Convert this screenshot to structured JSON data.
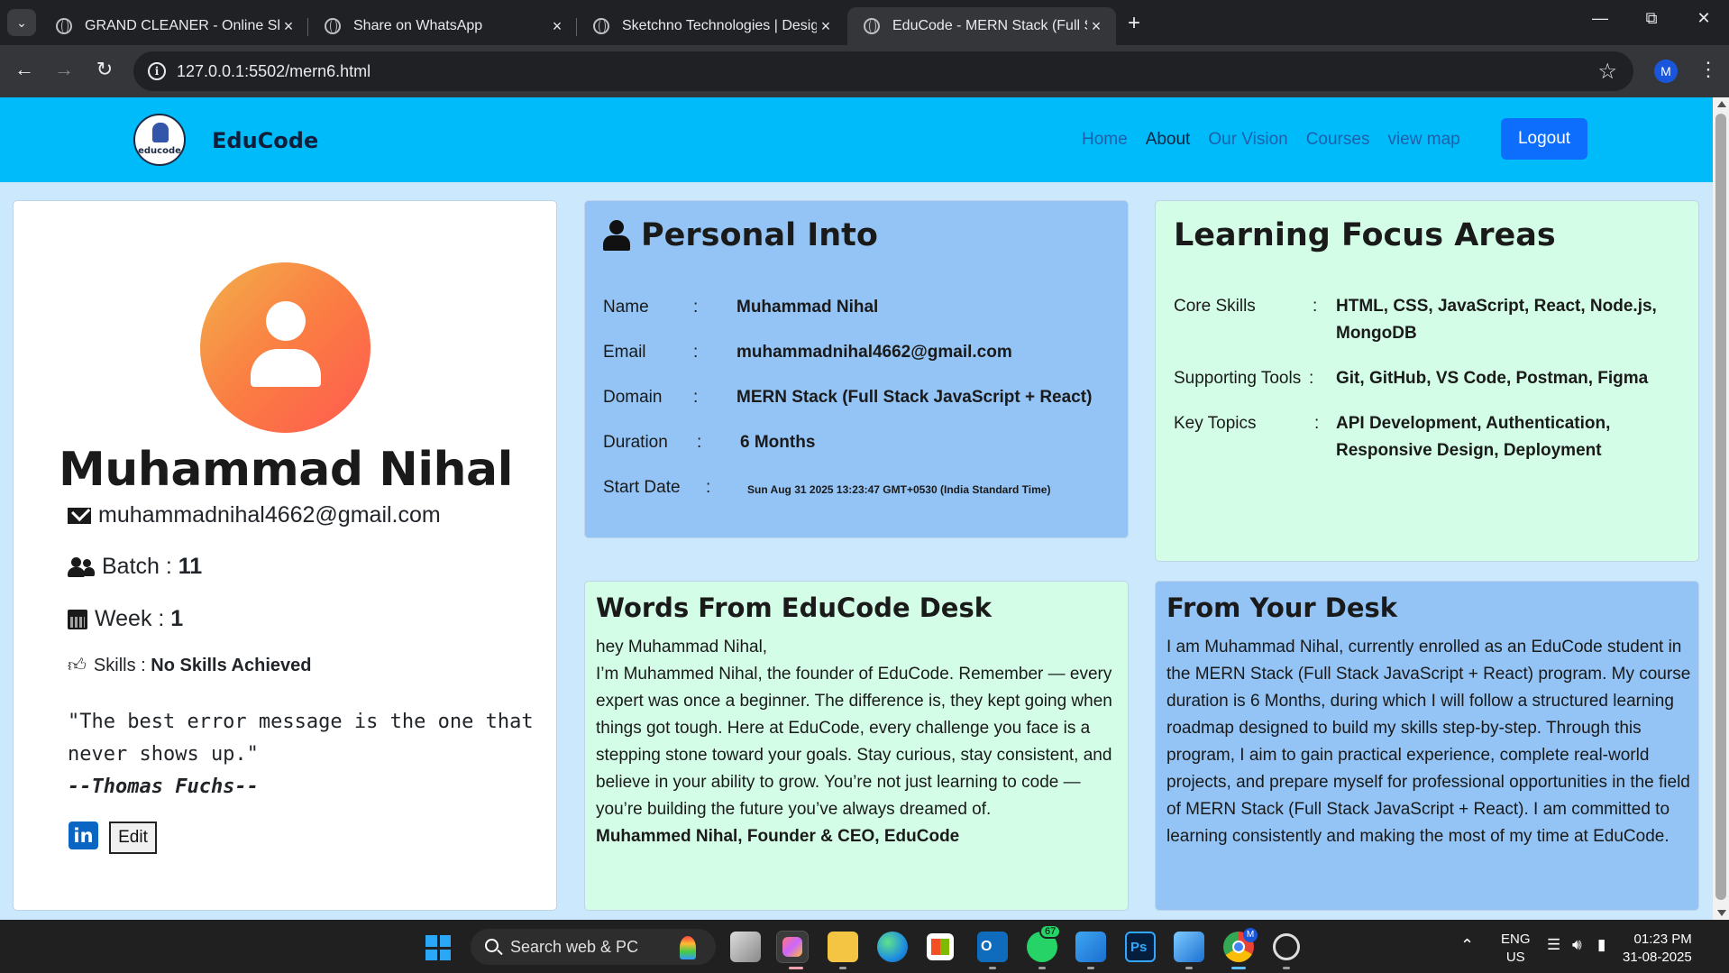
{
  "browser": {
    "tabs": [
      {
        "title": "GRAND CLEANER - Online Shop"
      },
      {
        "title": "Share on WhatsApp"
      },
      {
        "title": "Sketchno Technologies | Design"
      },
      {
        "title": "EduCode - MERN Stack (Full Stack"
      }
    ],
    "url": "127.0.0.1:5502/mern6.html",
    "profile_initial": "M"
  },
  "navbar": {
    "logo_text": "educode",
    "brand": "EduCode",
    "links": [
      "Home",
      "About",
      "Our Vision",
      "Courses",
      "view map"
    ],
    "active_link": "About",
    "logout": "Logout",
    "color": "#00bbfa"
  },
  "profile": {
    "name": "Muhammad Nihal",
    "email": "muhammadnihal4662@gmail.com",
    "batch_label": "Batch :",
    "batch": "11",
    "week_label": "Week :",
    "week": "1",
    "skills_label": "Skills :",
    "skills": "No Skills Achieved",
    "quote": "\"The best error message is the one that never shows up.\"",
    "quote_author": "--Thomas Fuchs--",
    "linkedin_text": "in",
    "edit": "Edit"
  },
  "personal": {
    "title": "Personal Into",
    "rows": [
      {
        "label": "Name",
        "value": "Muhammad Nihal"
      },
      {
        "label": "Email",
        "value": "muhammadnihal4662@gmail.com"
      },
      {
        "label": "Domain",
        "value": "MERN Stack (Full Stack JavaScript + React)"
      },
      {
        "label": "Duration",
        "value": "6 Months"
      },
      {
        "label": "Start Date",
        "value": "Sun Aug 31 2025 13:23:47 GMT+0530 (India Standard Time)"
      }
    ]
  },
  "focus": {
    "title": "Learning Focus Areas",
    "rows": [
      {
        "label": "Core Skills",
        "value": "HTML, CSS, JavaScript, React, Node.js, MongoDB"
      },
      {
        "label": "Supporting Tools",
        "value": "Git, GitHub, VS Code, Postman, Figma"
      },
      {
        "label": "Key Topics",
        "value": "API Development, Authentication, Responsive Design, Deployment"
      }
    ]
  },
  "words": {
    "title": "Words From EduCode Desk",
    "greeting": "hey Muhammad Nihal,",
    "body": "I’m Muhammed Nihal, the founder of EduCode. Remember — every expert was once a beginner. The difference is, they kept going when things got tough. Here at EduCode, every challenge you face is a stepping stone toward your goals. Stay curious, stay consistent, and believe in your ability to grow. You’re not just learning to code — you’re building the future you’ve always dreamed of.",
    "signature": "Muhammed Nihal, Founder & CEO, EduCode"
  },
  "desk": {
    "title": "From Your Desk",
    "body": "I am Muhammad Nihal, currently enrolled as an EduCode student in the MERN Stack (Full Stack JavaScript + React) program. My course duration is 6 Months, during which I will follow a structured learning roadmap designed to build my skills step-by-step. Through this program, I aim to gain practical experience, complete real-world projects, and prepare myself for professional opportunities in the field of MERN Stack (Full Stack JavaScript + React). I am committed to learning consistently and making the most of my time at EduCode."
  },
  "taskbar": {
    "search_placeholder": "Search web & PC",
    "whatsapp_badge": "67",
    "chrome_badge": "M",
    "lang": "ENG",
    "region": "US",
    "time": "01:23 PM",
    "date": "31-08-2025"
  }
}
